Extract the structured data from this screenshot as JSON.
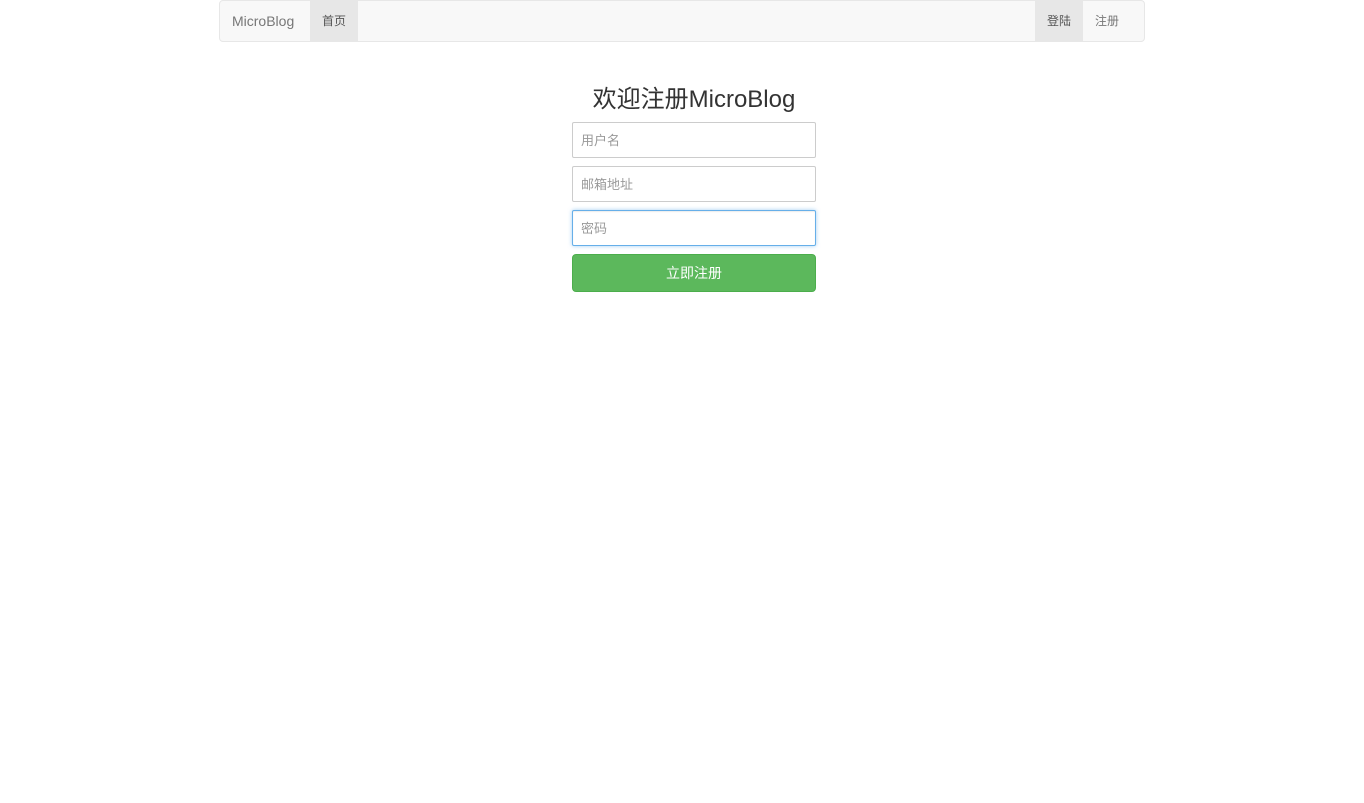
{
  "navbar": {
    "brand": "MicroBlog",
    "left_items": [
      {
        "label": "首页",
        "active": true
      }
    ],
    "right_items": [
      {
        "label": "登陆",
        "active": true
      },
      {
        "label": "注册",
        "active": false
      }
    ]
  },
  "register_form": {
    "title": "欢迎注册MicroBlog",
    "username": {
      "placeholder": "用户名",
      "value": ""
    },
    "email": {
      "placeholder": "邮箱地址",
      "value": ""
    },
    "password": {
      "placeholder": "密码",
      "value": ""
    },
    "submit_label": "立即注册"
  },
  "colors": {
    "primary_button": "#5cb85c",
    "focus_border": "#66afe9",
    "navbar_bg": "#f8f8f8",
    "active_nav_bg": "#e7e7e7"
  }
}
